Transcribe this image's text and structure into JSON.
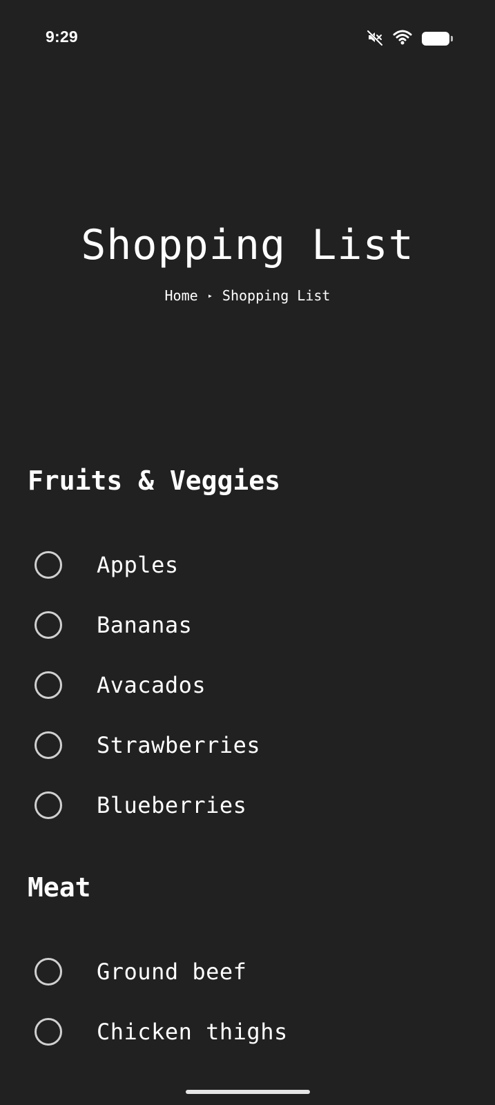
{
  "status_bar": {
    "time": "9:29",
    "icons": [
      "mute-icon",
      "wifi-icon",
      "battery-icon"
    ]
  },
  "header": {
    "title": "Shopping List",
    "breadcrumb": {
      "home": "Home",
      "separator": "▸",
      "current": "Shopping List"
    }
  },
  "sections": [
    {
      "title": "Fruits & Veggies",
      "items": [
        "Apples",
        "Bananas",
        "Avacados",
        "Strawberries",
        "Blueberries"
      ]
    },
    {
      "title": "Meat",
      "items": [
        "Ground beef",
        "Chicken thighs"
      ]
    }
  ],
  "colors": {
    "background": "#212121",
    "text": "#ffffff",
    "checkbox_border": "#d0d0d0"
  }
}
